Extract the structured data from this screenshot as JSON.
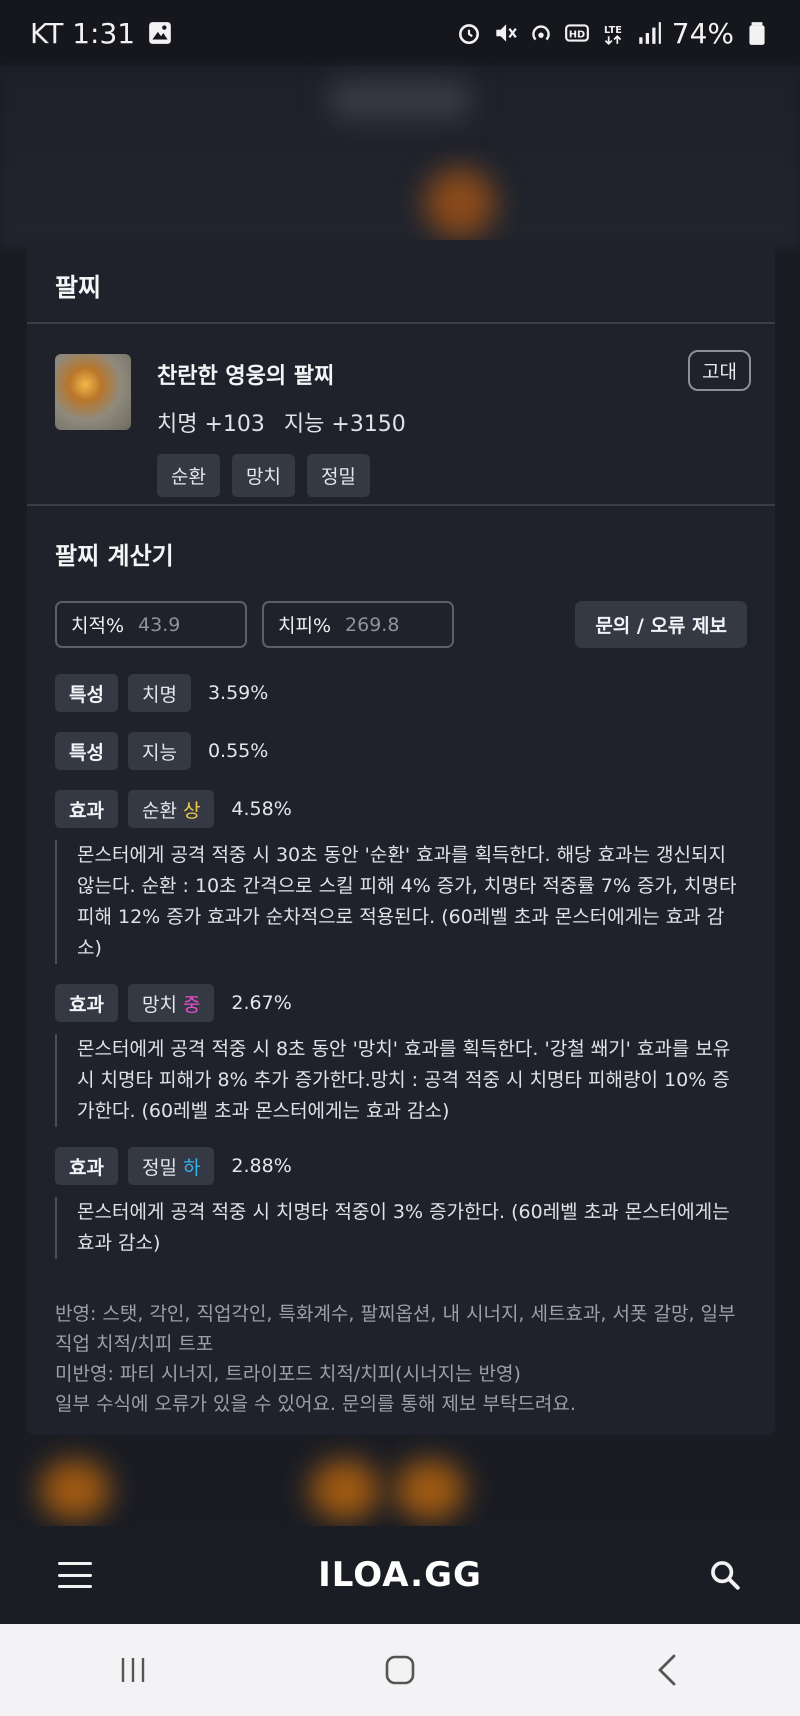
{
  "status_bar": {
    "carrier_time": "KT 1:31",
    "battery": "74%"
  },
  "modal": {
    "title": "팔찌",
    "item": {
      "name": "찬란한 영웅의 팔찌",
      "grade": "고대",
      "stats": [
        "치명 +103",
        "지능 +3150"
      ],
      "tags": [
        "순환",
        "망치",
        "정밀"
      ]
    },
    "calculator": {
      "title": "팔찌 계산기",
      "crit_rate_label": "치적%",
      "crit_rate_value": "43.9",
      "crit_dmg_label": "치피%",
      "crit_dmg_value": "269.8",
      "report_button": "문의 / 오류 제보",
      "options": [
        {
          "type": "특성",
          "name": "치명",
          "level": "",
          "value": "3.59%"
        },
        {
          "type": "특성",
          "name": "지능",
          "level": "",
          "value": "0.55%"
        },
        {
          "type": "효과",
          "name": "순환",
          "level": "상",
          "value": "4.58%",
          "description": "몬스터에게 공격 적중 시 30초 동안 '순환' 효과를 획득한다. 해당 효과는 갱신되지 않는다. 순환 : 10초 간격으로 스킬 피해 4% 증가, 치명타 적중률 7% 증가, 치명타 피해 12% 증가 효과가 순차적으로 적용된다. (60레벨 초과 몬스터에게는 효과 감소)"
        },
        {
          "type": "효과",
          "name": "망치",
          "level": "중",
          "value": "2.67%",
          "description": "몬스터에게 공격 적중 시 8초 동안 '망치' 효과를 획득한다. '강철 쐐기' 효과를 보유 시 치명타 피해가 8% 추가 증가한다.망치 : 공격 적중 시 치명타 피해량이 10% 증가한다. (60레벨 초과 몬스터에게는 효과 감소)"
        },
        {
          "type": "효과",
          "name": "정밀",
          "level": "하",
          "value": "2.88%",
          "description": "몬스터에게 공격 적중 시 치명타 적중이 3% 증가한다. (60레벨 초과 몬스터에게는 효과 감소)"
        }
      ],
      "footnotes": [
        "반영: 스탯, 각인, 직업각인, 특화계수, 팔찌옵션, 내 시너지, 세트효과, 서폿 갈망, 일부 직업 치적/치피 트포",
        "미반영: 파티 시너지, 트라이포드 치적/치피(시너지는 반영)",
        "일부 수식에 오류가 있을 수 있어요. 문의를 통해 제보 부탁드려요."
      ]
    }
  },
  "app_bar": {
    "logo": "ILOA.GG",
    "menu_icon": "menu-icon",
    "search_icon": "search-icon"
  },
  "colors": {
    "level_high": "#f2c94c",
    "level_mid": "#e44fd0",
    "level_low": "#35b5f0"
  }
}
